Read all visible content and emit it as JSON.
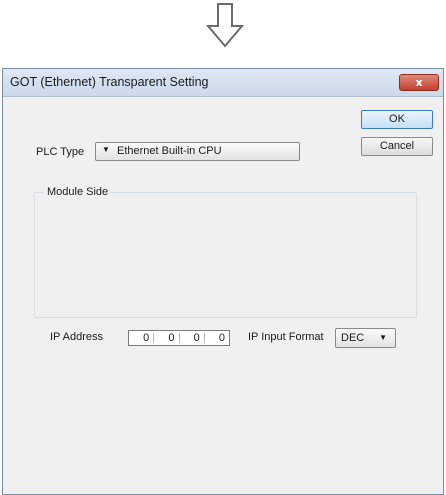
{
  "window": {
    "title": "GOT (Ethernet) Transparent Setting",
    "close_label": "x"
  },
  "buttons": {
    "ok": "OK",
    "cancel": "Cancel"
  },
  "plc_type": {
    "label": "PLC Type",
    "value": "Ethernet Built-in CPU"
  },
  "module_side": {
    "title": "Module Side",
    "ip_address_label": "IP Address",
    "ip_octets": [
      "0",
      "0",
      "0",
      "0"
    ],
    "ip_input_format_label": "IP Input Format",
    "ip_input_format_value": "DEC"
  },
  "icons": {
    "top_arrow": "down-arrow-icon",
    "combo_arrow": "dropdown-arrow-icon"
  }
}
